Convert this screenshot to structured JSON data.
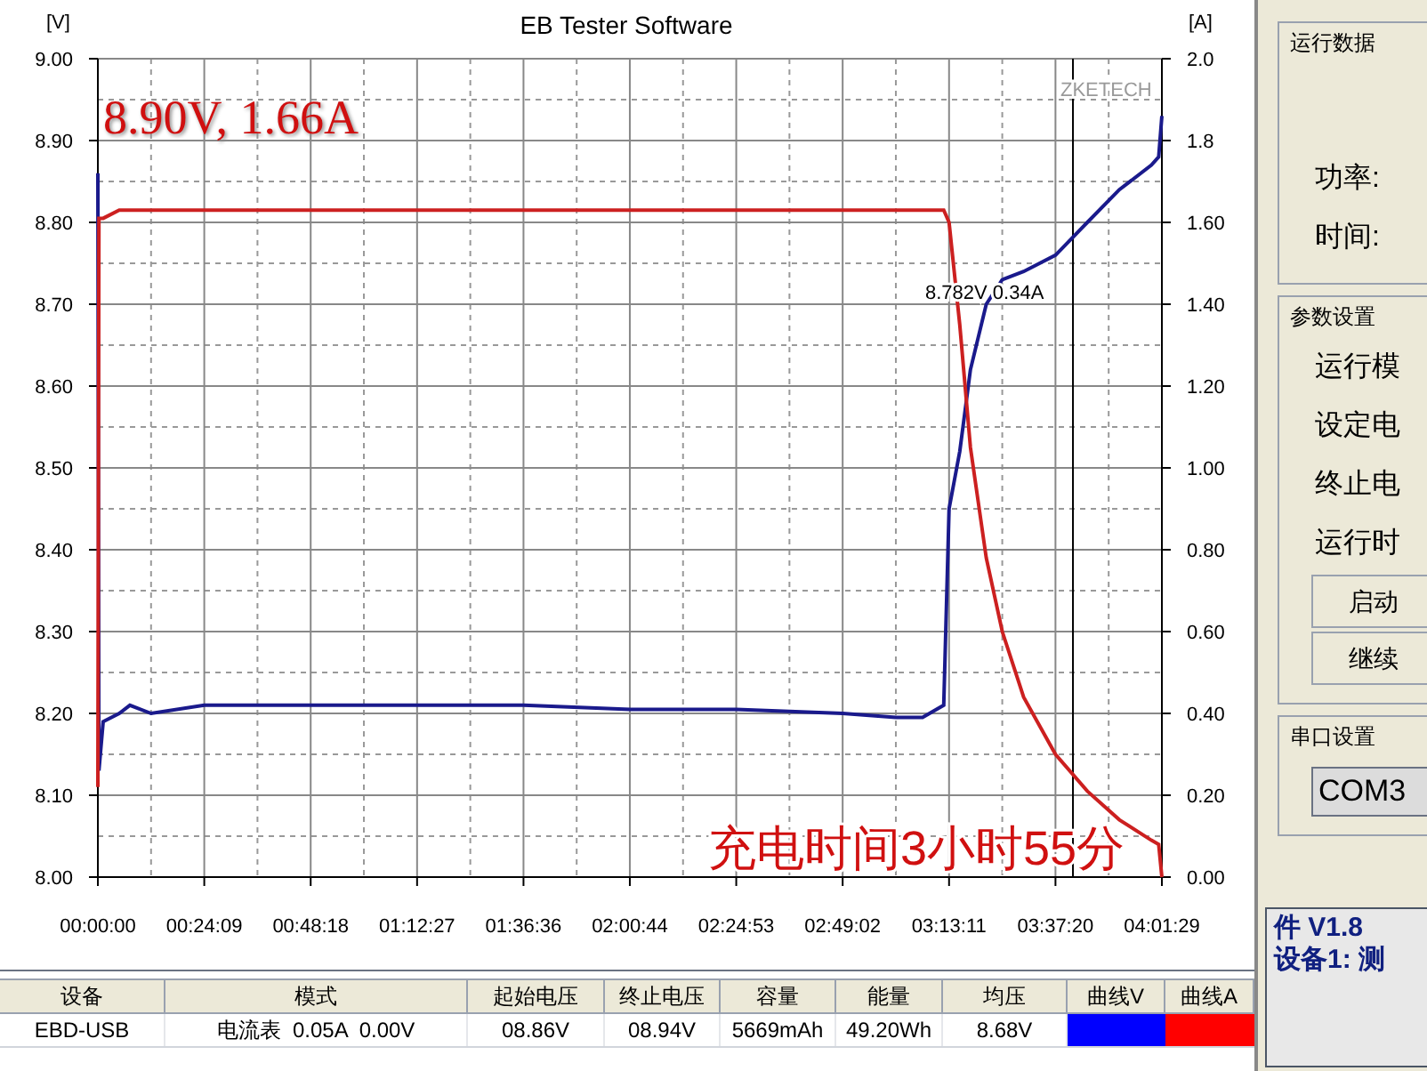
{
  "chart": {
    "chart_data": {
      "type": "line",
      "title": "EB Tester Software",
      "ylabel": "[V]",
      "y2label": "[A]",
      "x": [
        0,
        14,
        72,
        290,
        435,
        724,
        1449,
        2898,
        4347,
        5796,
        7244,
        8693,
        10142,
        10867,
        11229,
        11519,
        11591,
        11736,
        11881,
        12098,
        12316,
        12606,
        13040,
        13475,
        13910,
        14345,
        14446,
        14489
      ],
      "series": [
        {
          "color": "#1a1a8c",
          "values": [
            8.86,
            8.13,
            8.19,
            8.2,
            8.21,
            8.2,
            8.21,
            8.21,
            8.21,
            8.21,
            8.205,
            8.205,
            8.2,
            8.195,
            8.195,
            8.21,
            8.45,
            8.52,
            8.62,
            8.7,
            8.73,
            8.74,
            8.76,
            8.8,
            8.84,
            8.87,
            8.88,
            8.93
          ]
        },
        {
          "color": "#cc2020",
          "axis": "y2",
          "values": [
            0.22,
            1.61,
            1.61,
            1.63,
            1.63,
            1.63,
            1.63,
            1.63,
            1.63,
            1.63,
            1.63,
            1.63,
            1.63,
            1.63,
            1.63,
            1.63,
            1.6,
            1.35,
            1.05,
            0.78,
            0.6,
            0.44,
            0.3,
            0.21,
            0.14,
            0.09,
            0.08,
            0
          ]
        }
      ],
      "grid": true,
      "ref_lines": [
        {
          "axis": "x",
          "value": 13278,
          "color": "#000000"
        }
      ],
      "xlim": [
        0,
        14489
      ],
      "ylim": [
        8,
        9
      ],
      "y2lim": [
        0,
        2
      ],
      "xticks": [
        {
          "value": 0,
          "label": "00:00:00"
        },
        {
          "value": 1449,
          "label": "00:24:09"
        },
        {
          "value": 2898,
          "label": "00:48:18"
        },
        {
          "value": 4347,
          "label": "01:12:27"
        },
        {
          "value": 5796,
          "label": "01:36:36"
        },
        {
          "value": 7244,
          "label": "02:00:44"
        },
        {
          "value": 8693,
          "label": "02:24:53"
        },
        {
          "value": 10142,
          "label": "02:49:02"
        },
        {
          "value": 11591,
          "label": "03:13:11"
        },
        {
          "value": 13040,
          "label": "03:37:20"
        },
        {
          "value": 14489,
          "label": "04:01:29"
        }
      ],
      "yticks": [
        {
          "value": 8,
          "label": "8.00"
        },
        {
          "value": 8.1,
          "label": "8.10"
        },
        {
          "value": 8.2,
          "label": "8.20"
        },
        {
          "value": 8.3,
          "label": "8.30"
        },
        {
          "value": 8.4,
          "label": "8.40"
        },
        {
          "value": 8.5,
          "label": "8.50"
        },
        {
          "value": 8.6,
          "label": "8.60"
        },
        {
          "value": 8.7,
          "label": "8.70"
        },
        {
          "value": 8.8,
          "label": "8.80"
        },
        {
          "value": 8.9,
          "label": "8.90"
        },
        {
          "value": 9,
          "label": "9.00"
        }
      ],
      "y2ticks": [
        {
          "value": 0,
          "label": "0.00"
        },
        {
          "value": 0.2,
          "label": "0.20"
        },
        {
          "value": 0.4,
          "label": "0.40"
        },
        {
          "value": 0.6,
          "label": "0.60"
        },
        {
          "value": 0.8,
          "label": "0.80"
        },
        {
          "value": 1,
          "label": "1.00"
        },
        {
          "value": 1.2,
          "label": "1.20"
        },
        {
          "value": 1.4,
          "label": "1.40"
        },
        {
          "value": 1.6,
          "label": "1.60"
        },
        {
          "value": 1.8,
          "label": "1.8"
        },
        {
          "value": 2,
          "label": "2.0"
        }
      ],
      "annotations": [
        {
          "text": "8.90V, 1.66A"
        },
        {
          "text": "ZKETECH"
        },
        {
          "text": "8.782V 0.34A"
        },
        {
          "text": "充电时间3小时55分"
        }
      ]
    }
  },
  "table": {
    "columns": [
      "设备",
      "模式",
      "起始电压",
      "终止电压",
      "容量",
      "能量",
      "均压",
      "曲线V",
      "曲线A"
    ],
    "rows": [
      {
        "cells": [
          {
            "kind": "text",
            "text": "EBD-USB"
          },
          {
            "kind": "text",
            "text": "电流表  0.05A  0.00V"
          },
          {
            "kind": "text",
            "text": "08.86V"
          },
          {
            "kind": "text",
            "text": "08.94V"
          },
          {
            "kind": "text",
            "text": "5669mAh"
          },
          {
            "kind": "text",
            "text": "49.20Wh"
          },
          {
            "kind": "text",
            "text": "8.68V"
          },
          {
            "kind": "swatch",
            "color": "#0000ff"
          },
          {
            "kind": "swatch",
            "color": "#ff0000"
          }
        ]
      }
    ]
  },
  "side_panel": {
    "groups": [
      {
        "title": "运行数据",
        "items": [
          {
            "kind": "label",
            "text": "功率:"
          },
          {
            "kind": "label",
            "text": "时间:"
          }
        ]
      },
      {
        "title": "参数设置",
        "items": [
          {
            "kind": "label",
            "text": "运行模"
          },
          {
            "kind": "label",
            "text": "设定电"
          },
          {
            "kind": "label",
            "text": "终止电"
          },
          {
            "kind": "label",
            "text": "运行时"
          },
          {
            "kind": "button",
            "text": "启动"
          },
          {
            "kind": "button",
            "text": "继续"
          }
        ]
      },
      {
        "title": "串口设置",
        "items": [
          {
            "kind": "field",
            "text": "COM3"
          }
        ]
      }
    ],
    "info_lines": [
      "件 V1.8",
      "设备1: 测"
    ]
  }
}
